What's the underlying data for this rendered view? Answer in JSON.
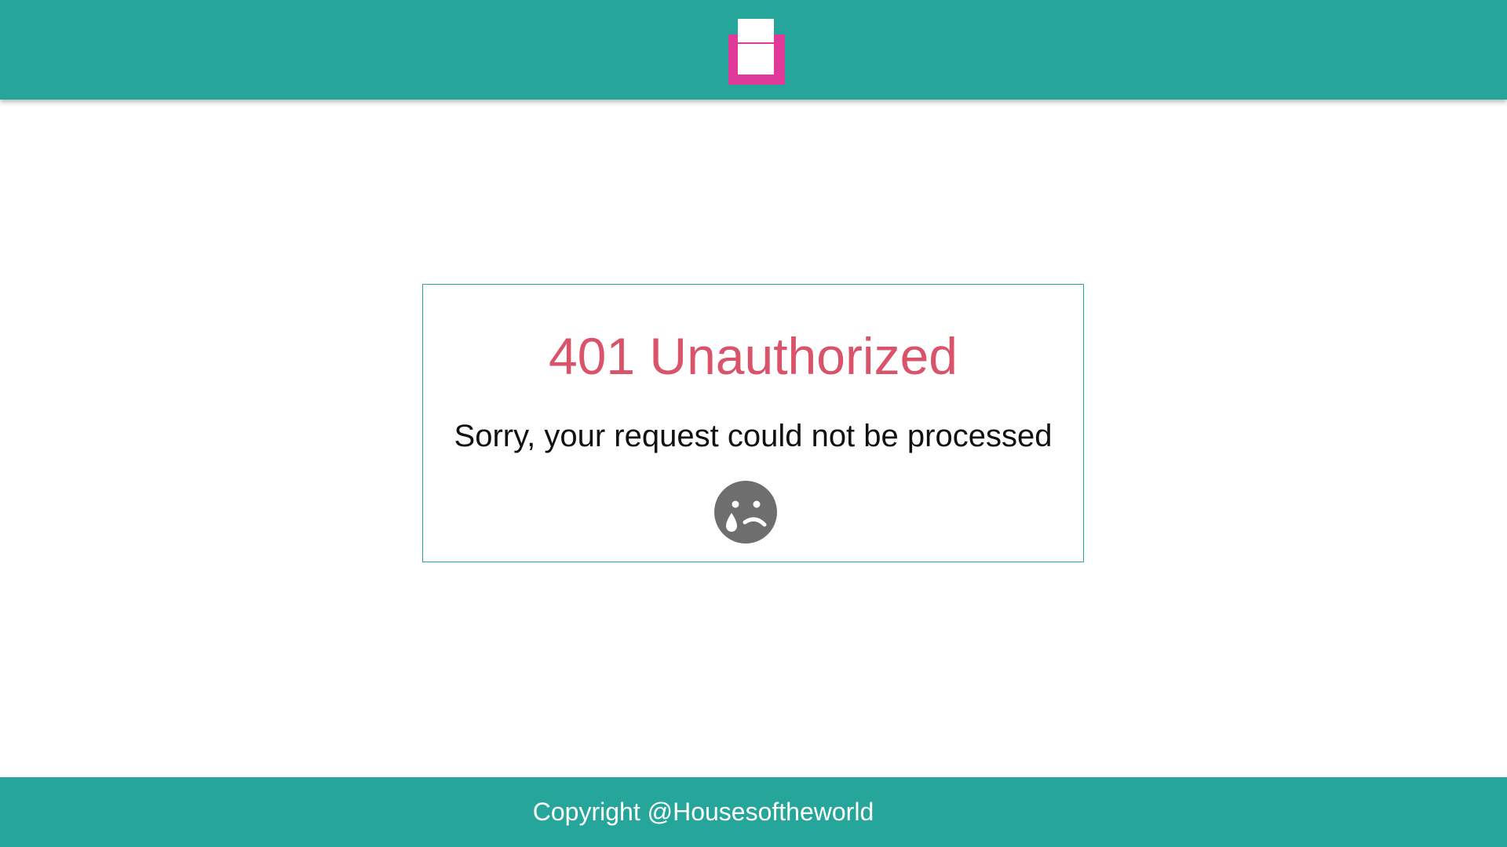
{
  "header": {
    "logo_icon": "house-logo-icon",
    "brand_color": "#26a69a",
    "logo_accent": "#e0399a"
  },
  "error": {
    "title": "401 Unauthorized",
    "message": "Sorry, your request could not be processed",
    "icon": "crying-face-icon",
    "title_color": "#d9546a"
  },
  "footer": {
    "copyright": "Copyright @Housesoftheworld"
  }
}
